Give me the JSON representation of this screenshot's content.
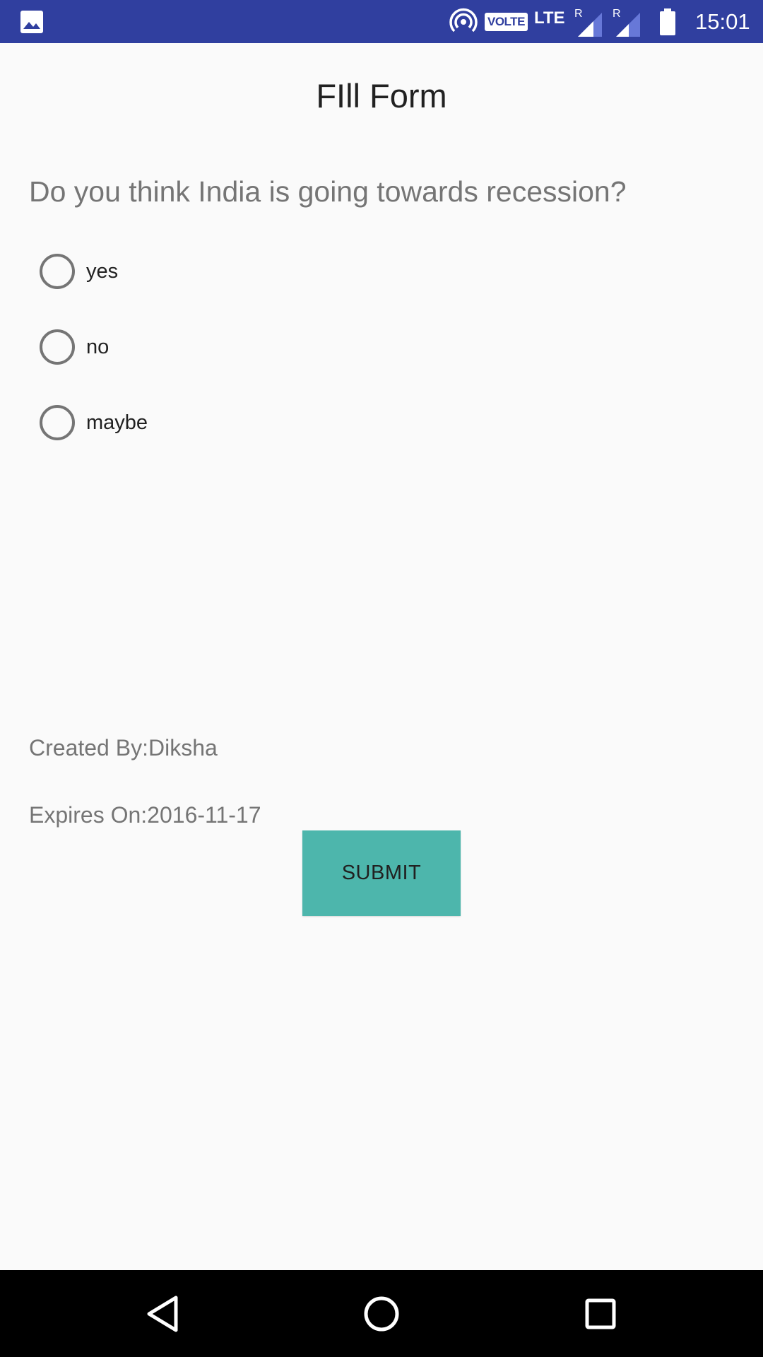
{
  "status_bar": {
    "time": "15:01",
    "volte": "VOLTE",
    "lte": "LTE",
    "roaming1": "R",
    "roaming2": "R",
    "icons": [
      "gallery-icon",
      "hotspot-icon",
      "signal-icon",
      "battery-icon"
    ]
  },
  "form": {
    "title": "FIll Form",
    "question": "Do you think India is going towards recession?",
    "options": [
      {
        "label": "yes",
        "selected": false
      },
      {
        "label": "no",
        "selected": false
      },
      {
        "label": "maybe",
        "selected": false
      }
    ],
    "created_by": "Created By:Diksha",
    "expires_on": "Expires On:2016-11-17",
    "submit_label": "SUBMIT"
  },
  "colors": {
    "status_bar": "#303f9f",
    "button": "#4db6ac",
    "background": "#fafafa",
    "nav_bar": "#000000"
  },
  "nav_bar": {
    "icons": [
      "back-icon",
      "home-icon",
      "recents-icon"
    ]
  }
}
